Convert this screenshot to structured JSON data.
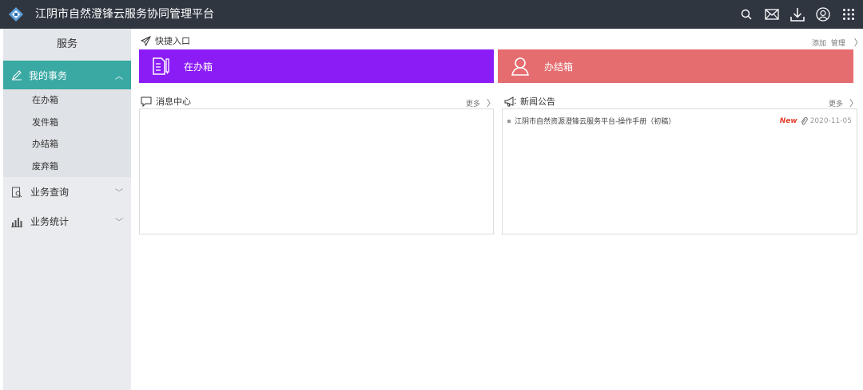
{
  "app": {
    "title": "江阴市自然澄锋云服务协同管理平台"
  },
  "topbar": {
    "icons": [
      "search-icon",
      "mail-icon",
      "download-icon",
      "user-icon",
      "apps-grid-icon"
    ]
  },
  "sidebar": {
    "header": "服务",
    "active_item": {
      "label": "我的事务",
      "icon": "pencil-icon"
    },
    "sub_items": [
      "在办箱",
      "发件箱",
      "办结箱",
      "废弃箱"
    ],
    "groups": [
      {
        "label": "业务查询",
        "icon": "document-search-icon"
      },
      {
        "label": "业务统计",
        "icon": "bar-chart-icon"
      }
    ]
  },
  "quick": {
    "title": "快捷入口",
    "add_label": "添加",
    "manage_label": "管理",
    "tiles": [
      {
        "label": "在办箱",
        "color": "#8b1cf6"
      },
      {
        "label": "办结箱",
        "color": "#e56d70"
      }
    ]
  },
  "messages": {
    "title": "消息中心",
    "more": "更多"
  },
  "news": {
    "title": "新闻公告",
    "more": "更多",
    "items": [
      {
        "text": "江阴市自然资源澄锋云服务平台-操作手册（初稿）",
        "badge": "New",
        "date": "2020-11-05"
      }
    ]
  },
  "colors": {
    "topbar": "#2f3640",
    "sidebar_active": "#3aa9a3"
  }
}
